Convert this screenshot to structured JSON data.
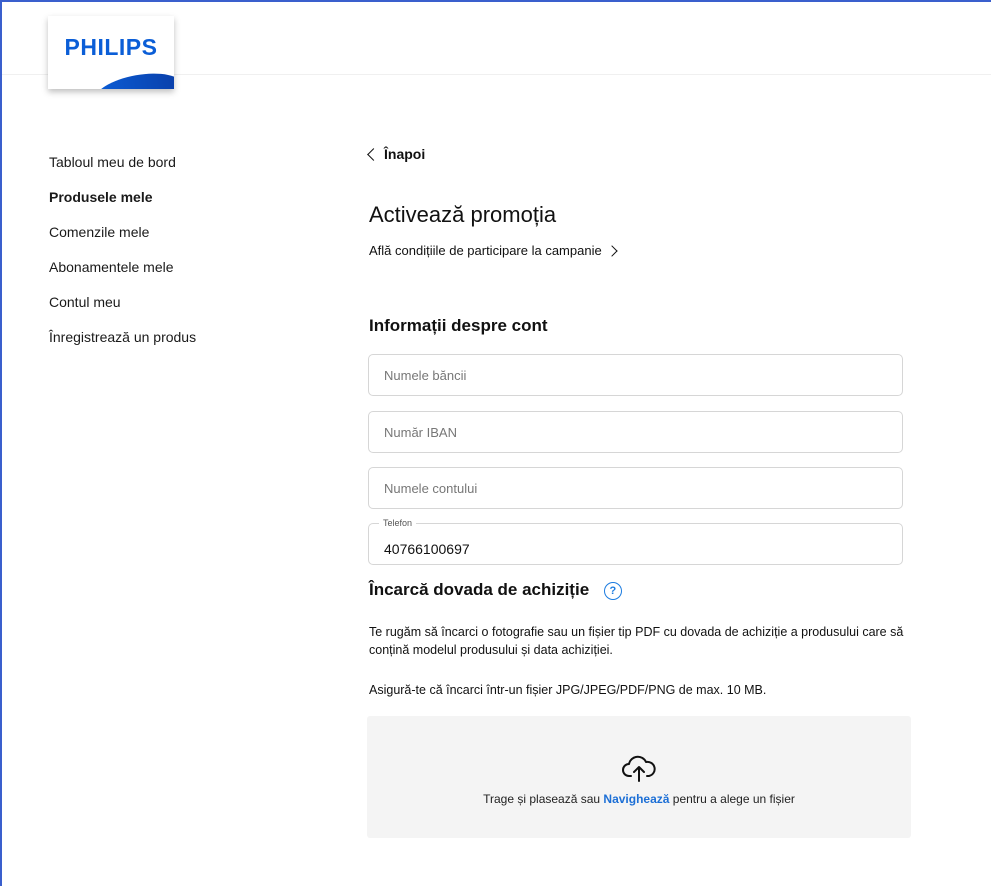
{
  "brand": {
    "logo_text": "PHILIPS",
    "accent_color": "#0b5ed7",
    "link_color": "#1c6fd6"
  },
  "sidebar": {
    "items": [
      {
        "label": "Tabloul meu de bord",
        "active": false
      },
      {
        "label": "Produsele mele",
        "active": true
      },
      {
        "label": "Comenzile mele",
        "active": false
      },
      {
        "label": "Abonamentele mele",
        "active": false
      },
      {
        "label": "Contul meu",
        "active": false
      },
      {
        "label": "Înregistrează un produs",
        "active": false
      }
    ]
  },
  "main": {
    "back_label": "Înapoi",
    "title": "Activează promoția",
    "conditions_link": "Află condițiile de participare la campanie",
    "account_section": {
      "title": "Informații despre cont",
      "fields": {
        "bank_name": {
          "placeholder": "Numele băncii",
          "value": ""
        },
        "iban": {
          "placeholder": "Număr IBAN",
          "value": ""
        },
        "account_name": {
          "placeholder": "Numele contului",
          "value": ""
        },
        "phone": {
          "label": "Telefon",
          "value": "40766100697"
        }
      }
    },
    "upload_section": {
      "title": "Încarcă dovada de achiziție",
      "help_icon": "question-circle-icon",
      "help_glyph": "?",
      "instructions": "Te rugăm să încarci o fotografie sau un fișier tip PDF cu dovada de achiziție a produsului care să conțină modelul produsului și data achiziției.",
      "file_requirements": "Asigură-te că încarci într-un fișier JPG/JPEG/PDF/PNG de max. 10 MB.",
      "dropzone": {
        "icon": "cloud-upload-icon",
        "text_before": "Trage și plasează sau ",
        "link": "Navighează",
        "text_after": " pentru a alege un fișier"
      }
    }
  }
}
